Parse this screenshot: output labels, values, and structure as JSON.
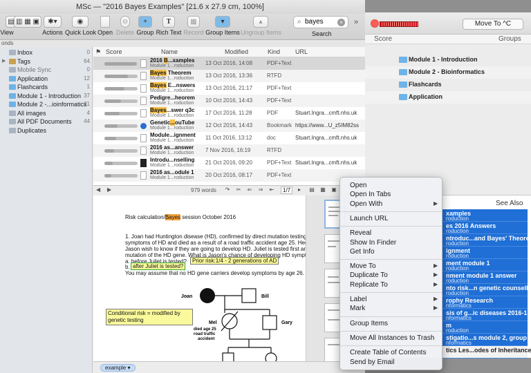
{
  "window_title": "MSc — \"2016 Bayes Examples\" [21.6 x 27.9 cm, 100%]",
  "toolbar": {
    "view_label": "View",
    "items": [
      {
        "label": "Actions"
      },
      {
        "label": "Quick Look"
      },
      {
        "label": "Open"
      },
      {
        "label": "Delete",
        "disabled": true
      },
      {
        "label": "Group"
      },
      {
        "label": "Rich Text"
      },
      {
        "label": "Record",
        "disabled": true
      },
      {
        "label": "Group Items"
      },
      {
        "label": "Ungroup Items",
        "disabled": true
      }
    ],
    "search_value": "bayes",
    "search_label": "Search"
  },
  "pathbar_text": "onds",
  "sidebar": [
    {
      "label": "Inbox",
      "count": "0"
    },
    {
      "label": "Tags",
      "count": "64"
    },
    {
      "label": "Mobile Sync",
      "count": "0"
    },
    {
      "label": "Application",
      "count": "12"
    },
    {
      "label": "Flashcards",
      "count": "1"
    },
    {
      "label": "Module 1 - Introduction",
      "count": "37"
    },
    {
      "label": "Module 2 -...ioinformatics",
      "count": "21"
    },
    {
      "label": "All images",
      "count": "4"
    },
    {
      "label": "All PDF Documents",
      "count": "44"
    },
    {
      "label": "Duplicates",
      "count": ""
    }
  ],
  "list": {
    "headers": {
      "score": "Score",
      "name": "Name",
      "modified": "Modified",
      "kind": "Kind",
      "url": "URL"
    },
    "rows": [
      {
        "pre": "2016 ",
        "hl": "B",
        "post": "...xamples",
        "group": "Module 1...roduction",
        "modified": "13 Oct 2016, 14:08",
        "kind": "PDF+Text",
        "url": "",
        "score": 0.95
      },
      {
        "pre": "",
        "hl": "Bayes",
        "post": " Theorem",
        "group": "Module 1...roduction",
        "modified": "13 Oct 2016, 13:36",
        "kind": "RTFD",
        "url": "",
        "score": 0.7
      },
      {
        "pre": "",
        "hl": "Bayes",
        "post": " E...nswers",
        "group": "Module 1...roduction",
        "modified": "13 Oct 2016, 21:17",
        "kind": "PDF+Text",
        "url": "",
        "score": 0.6
      },
      {
        "pre": "",
        "hl": "",
        "post": "Pedigre...heorem",
        "group": "Module 1...roduction",
        "modified": "10 Oct 2016, 14:43",
        "kind": "PDF+Text",
        "url": "",
        "score": 0.5
      },
      {
        "pre": "",
        "hl": "Bayes",
        "post": "...swer q3c",
        "group": "Module 1...roduction",
        "modified": "17 Oct 2016, 11:28",
        "kind": "PDF",
        "url": "Stuart.Ingra...cmft.nhs.uk",
        "score": 0.45
      },
      {
        "pre": "Genetic",
        "hl": "...",
        "post": "ouTube",
        "group": "Module 1...roduction",
        "modified": "12 Oct 2016, 14:43",
        "kind": "Bookmark",
        "url": "https://www...U_z5IM82ss",
        "score": 0.4
      },
      {
        "pre": "",
        "hl": "",
        "post": "Module...ignment",
        "group": "Module 1...roduction",
        "modified": "11 Oct 2016, 13:12",
        "kind": "doc",
        "url": "Stuart.Ingra...cmft.nhs.uk",
        "score": 0.35
      },
      {
        "pre": "",
        "hl": "",
        "post": "2016 as...answer",
        "group": "Module 1...roduction",
        "modified": "7 Nov 2016, 16:19",
        "kind": "RTFD",
        "url": "",
        "score": 0.3
      },
      {
        "pre": "",
        "hl": "",
        "post": "Introdu...nselling",
        "group": "Module 1...roduction",
        "modified": "21 Oct 2016, 09:20",
        "kind": "PDF+Text",
        "url": "Stuart.Ingra...cmft.nhs.uk",
        "score": 0.25
      },
      {
        "pre": "",
        "hl": "",
        "post": "2016 as...odule 1",
        "group": "Module 1...roduction",
        "modified": "20 Oct 2016, 08:17",
        "kind": "PDF+Text",
        "url": "",
        "score": 0.2
      }
    ],
    "word_count": "979 words",
    "page_indicator": "1/7"
  },
  "document": {
    "title_pre": "Risk calculation/",
    "title_hl": "Bayes",
    "title_post": " session October 2016",
    "lines": [
      "1. Joan had Huntington disease (HD), confirmed by direct mutation testing. He",
      "symptoms of HD and died as a result of a road traffic accident age 25. Her gra",
      "Jason wish to know if they are going to develop HD. Juliet is tested first and is",
      "mutation of the HD gene. What is Jason's chance of developing HD symptoms"
    ],
    "option_a": "a.   before Juliet is tested?",
    "option_b": "b.",
    "option_b_box": "after Juliet is tested?",
    "prior_box": "Prior risk:1/4 - 2 generations of AD",
    "assume": "You may assume that no HD gene carriers develop symptoms by age 26.",
    "conditional_box": "Conditional risk = modified by genetic testing",
    "pedigree": {
      "joan": "Joan",
      "bill": "Bill",
      "mel": "Mel",
      "gary": "Gary",
      "mel_note": [
        "died age 25",
        "road traffic",
        "accident"
      ]
    }
  },
  "tag_token": "example",
  "context_menu": {
    "groups": [
      [
        {
          "label": "Open"
        },
        {
          "label": "Open In Tabs"
        },
        {
          "label": "Open With",
          "submenu": true
        }
      ],
      [
        {
          "label": "Launch URL"
        }
      ],
      [
        {
          "label": "Reveal"
        },
        {
          "label": "Show In Finder"
        },
        {
          "label": "Get Info"
        }
      ],
      [
        {
          "label": "Move To",
          "submenu": true
        },
        {
          "label": "Duplicate To",
          "submenu": true
        },
        {
          "label": "Replicate To",
          "submenu": true
        }
      ],
      [
        {
          "label": "Label",
          "submenu": true
        },
        {
          "label": "Mark",
          "submenu": true
        }
      ],
      [
        {
          "label": "Group Items"
        }
      ],
      [
        {
          "label": "Move All Instances to Trash"
        }
      ],
      [
        {
          "label": "Create Table of Contents"
        },
        {
          "label": "Send by Email"
        }
      ]
    ]
  },
  "back_window": {
    "move_to_label": "Move To ^C",
    "header_score": "Score",
    "header_groups": "Groups",
    "groups": [
      "Module 1 - Introduction",
      "Module 2 - Bioinformatics",
      "Flashcards",
      "Application"
    ],
    "see_also_label": "See Also",
    "see_also": [
      {
        "title": "xamples",
        "sub": "roduction"
      },
      {
        "title": "es 2016 Answers",
        "sub": "roduction"
      },
      {
        "title": "ntroduc...and Bayes' Theorem",
        "sub": "roduction"
      },
      {
        "title": "ignment",
        "sub": "roduction"
      },
      {
        "title": "ment module 1",
        "sub": "roduction"
      },
      {
        "title": "nment module 1 answer",
        "sub": "roduction"
      },
      {
        "title": "nto risk...n genetic counselling",
        "sub": "roduction"
      },
      {
        "title": "rophy Research",
        "sub": "nformatics"
      },
      {
        "title": "sis of g...ic diseases 2016-17",
        "sub": "nformatics"
      },
      {
        "title": "m",
        "sub": "roduction"
      },
      {
        "title": "stigatio...s module 2, group 7",
        "sub": "nformatics"
      },
      {
        "title": "tics Les...odes of Inheritance",
        "sub": ""
      }
    ]
  }
}
